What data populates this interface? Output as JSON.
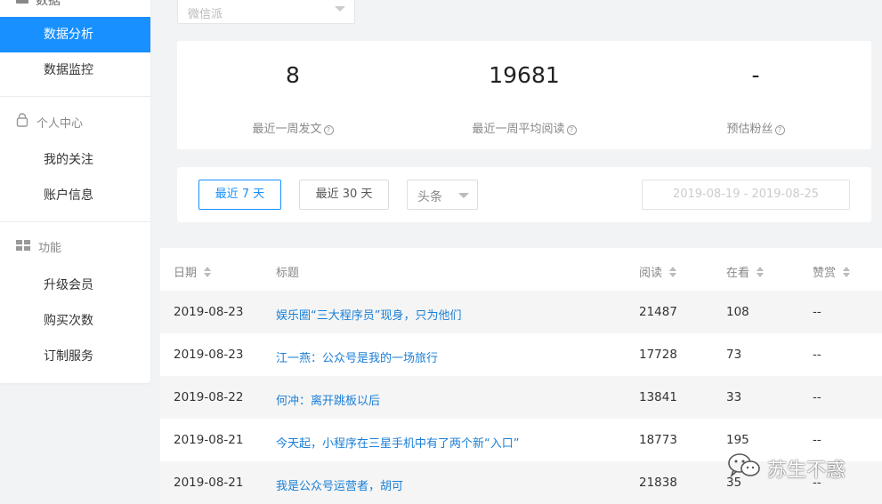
{
  "sidebar": {
    "top_group_label": "数据",
    "items_top": [
      {
        "label": "数据分析",
        "active": true
      },
      {
        "label": "数据监控",
        "active": false
      }
    ],
    "group_personal": {
      "label": "个人中心",
      "icon": "user-icon",
      "items": [
        {
          "label": "我的关注"
        },
        {
          "label": "账户信息"
        }
      ]
    },
    "group_features": {
      "label": "功能",
      "icon": "grid-icon",
      "items": [
        {
          "label": "升级会员"
        },
        {
          "label": "购买次数"
        },
        {
          "label": "订制服务"
        }
      ]
    }
  },
  "account_select": {
    "value": "微信派"
  },
  "stats": [
    {
      "value": "8",
      "label": "最近一周发文"
    },
    {
      "value": "19681",
      "label": "最近一周平均阅读"
    },
    {
      "value": "-",
      "label": "预估粉丝"
    }
  ],
  "filters": {
    "range_7": "最近 7 天",
    "range_30": "最近 30 天",
    "position_select": "头条",
    "date_range": "2019-08-19 - 2019-08-25"
  },
  "table": {
    "headers": {
      "date": "日期",
      "title": "标题",
      "reads": "阅读",
      "watching": "在看",
      "reward": "赞赏"
    },
    "rows": [
      {
        "date": "2019-08-23",
        "title": "娱乐圈“三大程序员”现身，只为他们",
        "reads": "21487",
        "watching": "108",
        "reward": "--"
      },
      {
        "date": "2019-08-23",
        "title": "江一燕：公众号是我的一场旅行",
        "reads": "17728",
        "watching": "73",
        "reward": "--"
      },
      {
        "date": "2019-08-22",
        "title": "何冲：离开跳板以后",
        "reads": "13841",
        "watching": "33",
        "reward": "--"
      },
      {
        "date": "2019-08-21",
        "title": "今天起，小程序在三星手机中有了两个新“入口”",
        "reads": "18773",
        "watching": "195",
        "reward": "--"
      },
      {
        "date": "2019-08-21",
        "title": "我是公众号运营者，胡可",
        "reads": "21838",
        "watching": "35",
        "reward": "--"
      }
    ]
  },
  "watermark": {
    "text": "苏生不惑",
    "icon": "wechat-icon"
  },
  "colors": {
    "accent": "#1890ff",
    "link": "#1a7fd6"
  }
}
